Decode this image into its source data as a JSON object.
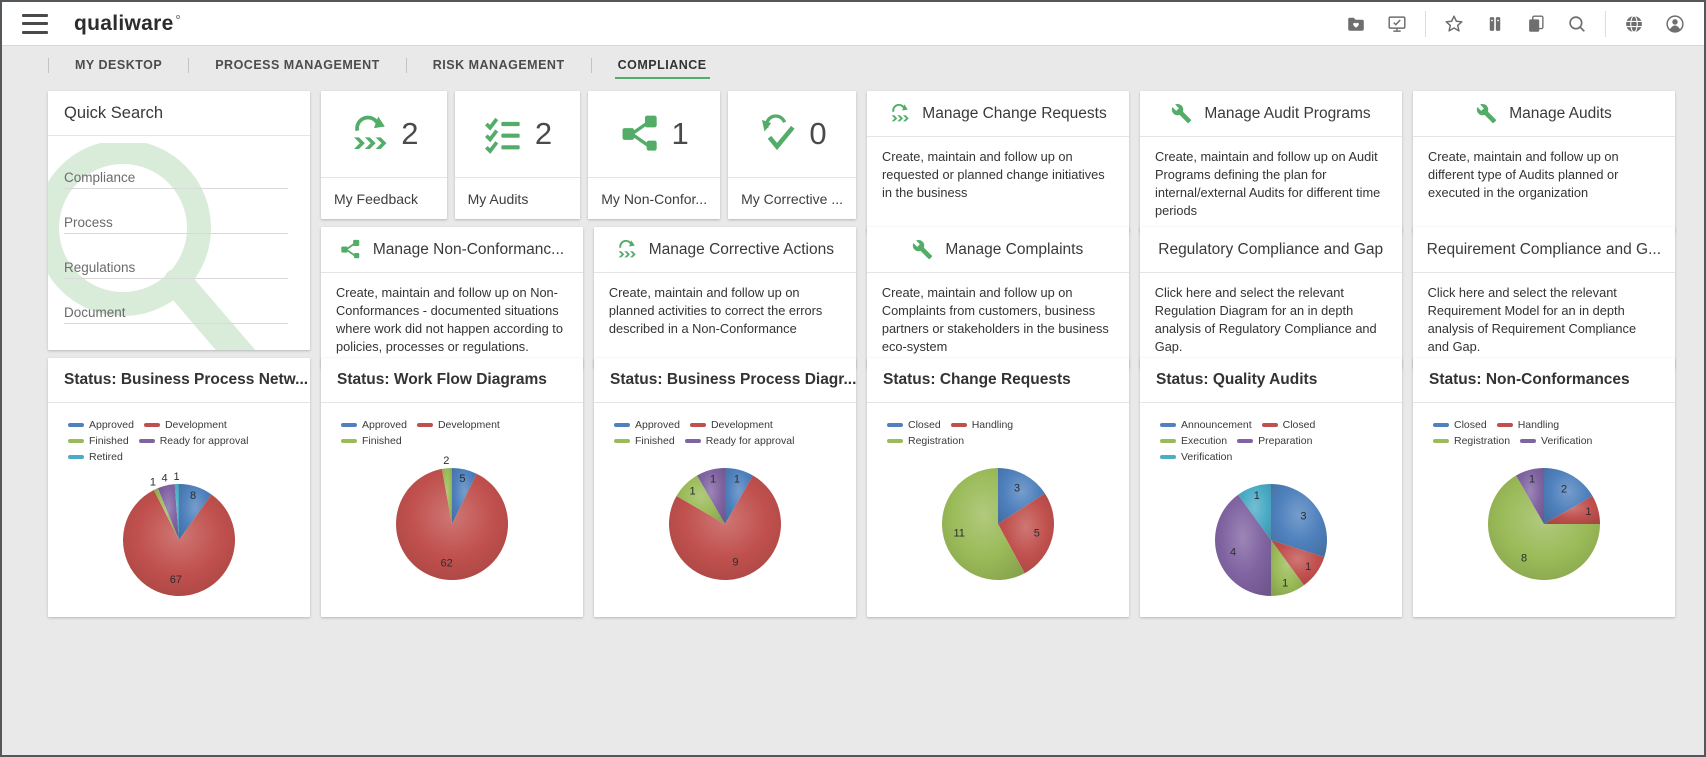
{
  "colors": {
    "accent_green": "#53ad68",
    "watermark_green": "#d9ecda",
    "icon_gray": "#6e6e6e",
    "tab_active_underline": "#53ad68",
    "chart_blue": "#4F81BD",
    "chart_red": "#C0504D",
    "chart_green": "#9BBB59",
    "chart_purple": "#8064A2",
    "chart_cyan": "#4BACC6"
  },
  "topbar": {
    "logo": "qualiware",
    "icons": [
      "media-folder-icon",
      "monitor-check-icon",
      "favorites-star-icon",
      "binders-icon",
      "copy-icon",
      "search-icon",
      "globe-icon",
      "account-icon"
    ]
  },
  "tabs": [
    {
      "label": "MY DESKTOP",
      "active": false
    },
    {
      "label": "PROCESS MANAGEMENT",
      "active": false
    },
    {
      "label": "RISK MANAGEMENT",
      "active": false
    },
    {
      "label": "COMPLIANCE",
      "active": true
    }
  ],
  "quick_search": {
    "title": "Quick Search",
    "fields": [
      {
        "label": "Compliance"
      },
      {
        "label": "Process"
      },
      {
        "label": "Regulations"
      },
      {
        "label": "Document"
      }
    ]
  },
  "stat_cards": [
    {
      "icon": "feedback-loop-icon",
      "count": "2",
      "label": "My Feedback"
    },
    {
      "icon": "checklist-icon",
      "count": "2",
      "label": "My Audits"
    },
    {
      "icon": "share-icon",
      "count": "1",
      "label": "My Non-Confor..."
    },
    {
      "icon": "double-check-icon",
      "count": "0",
      "label": "My Corrective ..."
    }
  ],
  "manage_cards": [
    {
      "icon": "feedback-loop-icon",
      "title": "Manage Change Requests",
      "description": "Create, maintain and follow up on requested or planned change initiatives in the business"
    },
    {
      "icon": "wrench-icon",
      "title": "Manage Audit Programs",
      "description": "Create, maintain and follow up on Audit Programs defining the plan for internal/external Audits for different time periods"
    },
    {
      "icon": "wrench-icon",
      "title": "Manage Audits",
      "description": "Create, maintain and follow up on different type of Audits planned or executed in the organization"
    },
    {
      "icon": "share-icon",
      "title": "Manage Non-Conformanc...",
      "description": "Create, maintain and follow up on Non-Conformances - documented situations where work did not happen according to policies, processes or regulations."
    },
    {
      "icon": "feedback-loop-icon",
      "title": "Manage Corrective Actions",
      "description": "Create, maintain and follow up on planned activities to correct the errors described in a Non-Conformance"
    },
    {
      "icon": "wrench-icon",
      "title": "Manage Complaints",
      "description": "Create, maintain and follow up on Complaints from customers, business partners or stakeholders in the business eco-system"
    },
    {
      "icon": null,
      "title": "Regulatory Compliance and Gap",
      "description": "Click here and select the relevant Regulation Diagram for an in depth analysis of Regulatory Compliance and Gap."
    },
    {
      "icon": null,
      "title": "Requirement Compliance and G...",
      "description": "Click here and select the relevant Requirement Model for an in depth analysis of Requirement Compliance and Gap."
    }
  ],
  "chart_data": [
    {
      "type": "pie",
      "title": "Status: Business Process Netw...",
      "labels": [
        "Approved",
        "Development",
        "Finished",
        "Ready for approval",
        "Retired"
      ],
      "values": [
        8,
        67,
        1,
        4,
        1
      ],
      "colors": [
        "#4F81BD",
        "#C0504D",
        "#9BBB59",
        "#8064A2",
        "#4BACC6"
      ],
      "legend_position": "top",
      "data_labels": true
    },
    {
      "type": "pie",
      "title": "Status: Work Flow Diagrams",
      "labels": [
        "Approved",
        "Development",
        "Finished"
      ],
      "values": [
        5,
        62,
        2
      ],
      "colors": [
        "#4F81BD",
        "#C0504D",
        "#9BBB59"
      ],
      "legend_position": "top",
      "data_labels": true
    },
    {
      "type": "pie",
      "title": "Status: Business Process Diagr...",
      "labels": [
        "Approved",
        "Development",
        "Finished",
        "Ready for approval"
      ],
      "values": [
        1,
        9,
        1,
        1
      ],
      "colors": [
        "#4F81BD",
        "#C0504D",
        "#9BBB59",
        "#8064A2"
      ],
      "legend_position": "top",
      "data_labels": true
    },
    {
      "type": "pie",
      "title": "Status: Change Requests",
      "labels": [
        "Closed",
        "Handling",
        "Registration"
      ],
      "values": [
        3,
        5,
        11
      ],
      "colors": [
        "#4F81BD",
        "#C0504D",
        "#9BBB59"
      ],
      "legend_position": "top",
      "data_labels": true
    },
    {
      "type": "pie",
      "title": "Status: Quality Audits",
      "labels": [
        "Announcement",
        "Closed",
        "Execution",
        "Preparation",
        "Verification"
      ],
      "values": [
        3,
        1,
        1,
        4,
        1
      ],
      "colors": [
        "#4F81BD",
        "#C0504D",
        "#9BBB59",
        "#8064A2",
        "#4BACC6"
      ],
      "legend_position": "top",
      "data_labels": true
    },
    {
      "type": "pie",
      "title": "Status: Non-Conformances",
      "labels": [
        "Closed",
        "Handling",
        "Registration",
        "Verification"
      ],
      "values": [
        2,
        1,
        8,
        1
      ],
      "colors": [
        "#4F81BD",
        "#C0504D",
        "#9BBB59",
        "#8064A2"
      ],
      "legend_position": "top",
      "data_labels": true
    }
  ]
}
